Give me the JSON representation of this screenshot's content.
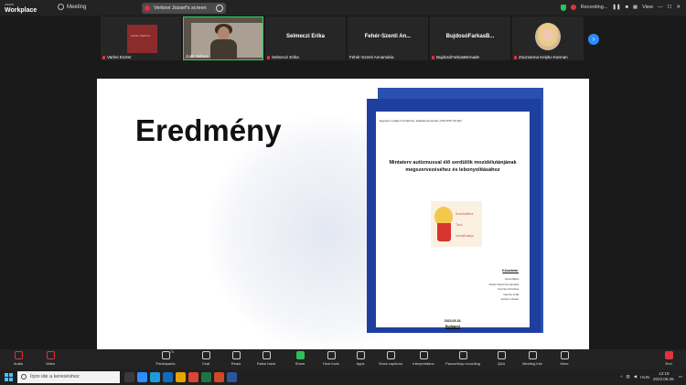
{
  "titlebar": {
    "brand_small": "zoom",
    "brand": "Workplace",
    "meeting_label": "Meeting",
    "share_label": "Verbovi Jozsef's screen",
    "recording_label": "Recording...",
    "view_label": "View"
  },
  "participants": [
    {
      "name": "Varhei Eszter",
      "book_text": "LEVEL MEZON"
    },
    {
      "name": "Judit Sebesi"
    },
    {
      "name": "Selmeczi Erika",
      "display": "Selmeczi Erika"
    },
    {
      "name": "Fehér-Szenti Annamária",
      "display": "Fehér-Szenti An..."
    },
    {
      "name": "BujdosóFarkasBernade",
      "display": "BujdosóFarkasB..."
    },
    {
      "name": "Zsuzsanna Kelyko Karman"
    }
  ],
  "slide": {
    "heading": "Eredmény",
    "doc_small": "Egyetemi szakjei hozzáférés, akadálymentesítés_MILOPTK 09-004",
    "doc_title": "Mintaterv autizmussal élő serdülők mozidélutánjának megszervezéséhez és lebonyolításához",
    "logo_line1": "Szombattétve",
    "logo_line2": "Tizok",
    "logo_line3": "mozidélutánja",
    "author_heading": "Készítette:",
    "authors": [
      "Dora Mária",
      "Fehér-Szenti Annamária",
      "Kurmus Krisztina",
      "Nennis Judit",
      "Verbovi József"
    ],
    "date": "2023.05.18.",
    "city": "Budapest"
  },
  "toolbar": {
    "audio": "Audio",
    "video": "Video",
    "participants_count": "74",
    "participants": "Participants",
    "chat": "Chat",
    "react": "React",
    "raise_hand": "Raise hand",
    "share": "Share",
    "host_tools": "Host tools",
    "apps": "Apps",
    "captions": "Show captions",
    "interpretation": "Interpretation",
    "pause_rec": "Pause/stop recording",
    "qa": "Q&A",
    "meeting_info": "Meeting info",
    "more": "More",
    "end": "End"
  },
  "taskbar": {
    "search_placeholder": "Írjon ide a kereséshez",
    "lang": "HUN",
    "time": "12:19",
    "date": "2023.06.06."
  },
  "colors": {
    "accent": "#2d8cff",
    "recording": "#e0323e",
    "active_speaker": "#2fd05c",
    "doc_border": "#1e3f9e"
  }
}
